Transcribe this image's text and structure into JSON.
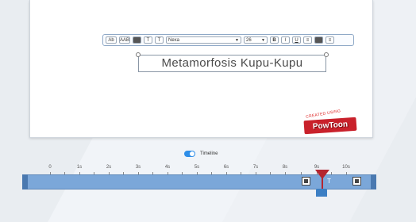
{
  "toolbar": {
    "btn_ab": "Ab",
    "btn_aab": "AAB",
    "btn_tx": "T",
    "btn_tx2": "T",
    "font_value": "Nexa",
    "size_value": "26",
    "btn_bold": "B",
    "btn_italic": "I",
    "btn_underline": "U"
  },
  "canvas": {
    "text": "Metamorfosis Kupu-Kupu"
  },
  "logo": {
    "top": "CREATED USING",
    "main": "PowToon"
  },
  "timeline": {
    "toggle_label": "Timeline",
    "ticks": [
      "0",
      "1s",
      "2s",
      "3s",
      "4s",
      "5s",
      "6s",
      "7s",
      "8s",
      "9s",
      "10s"
    ],
    "marker_label": "T"
  },
  "colors": {
    "track": "#7ba7d9",
    "playhead": "#b4252f",
    "toggle": "#2f8ee8",
    "logo": "#c9212b"
  }
}
